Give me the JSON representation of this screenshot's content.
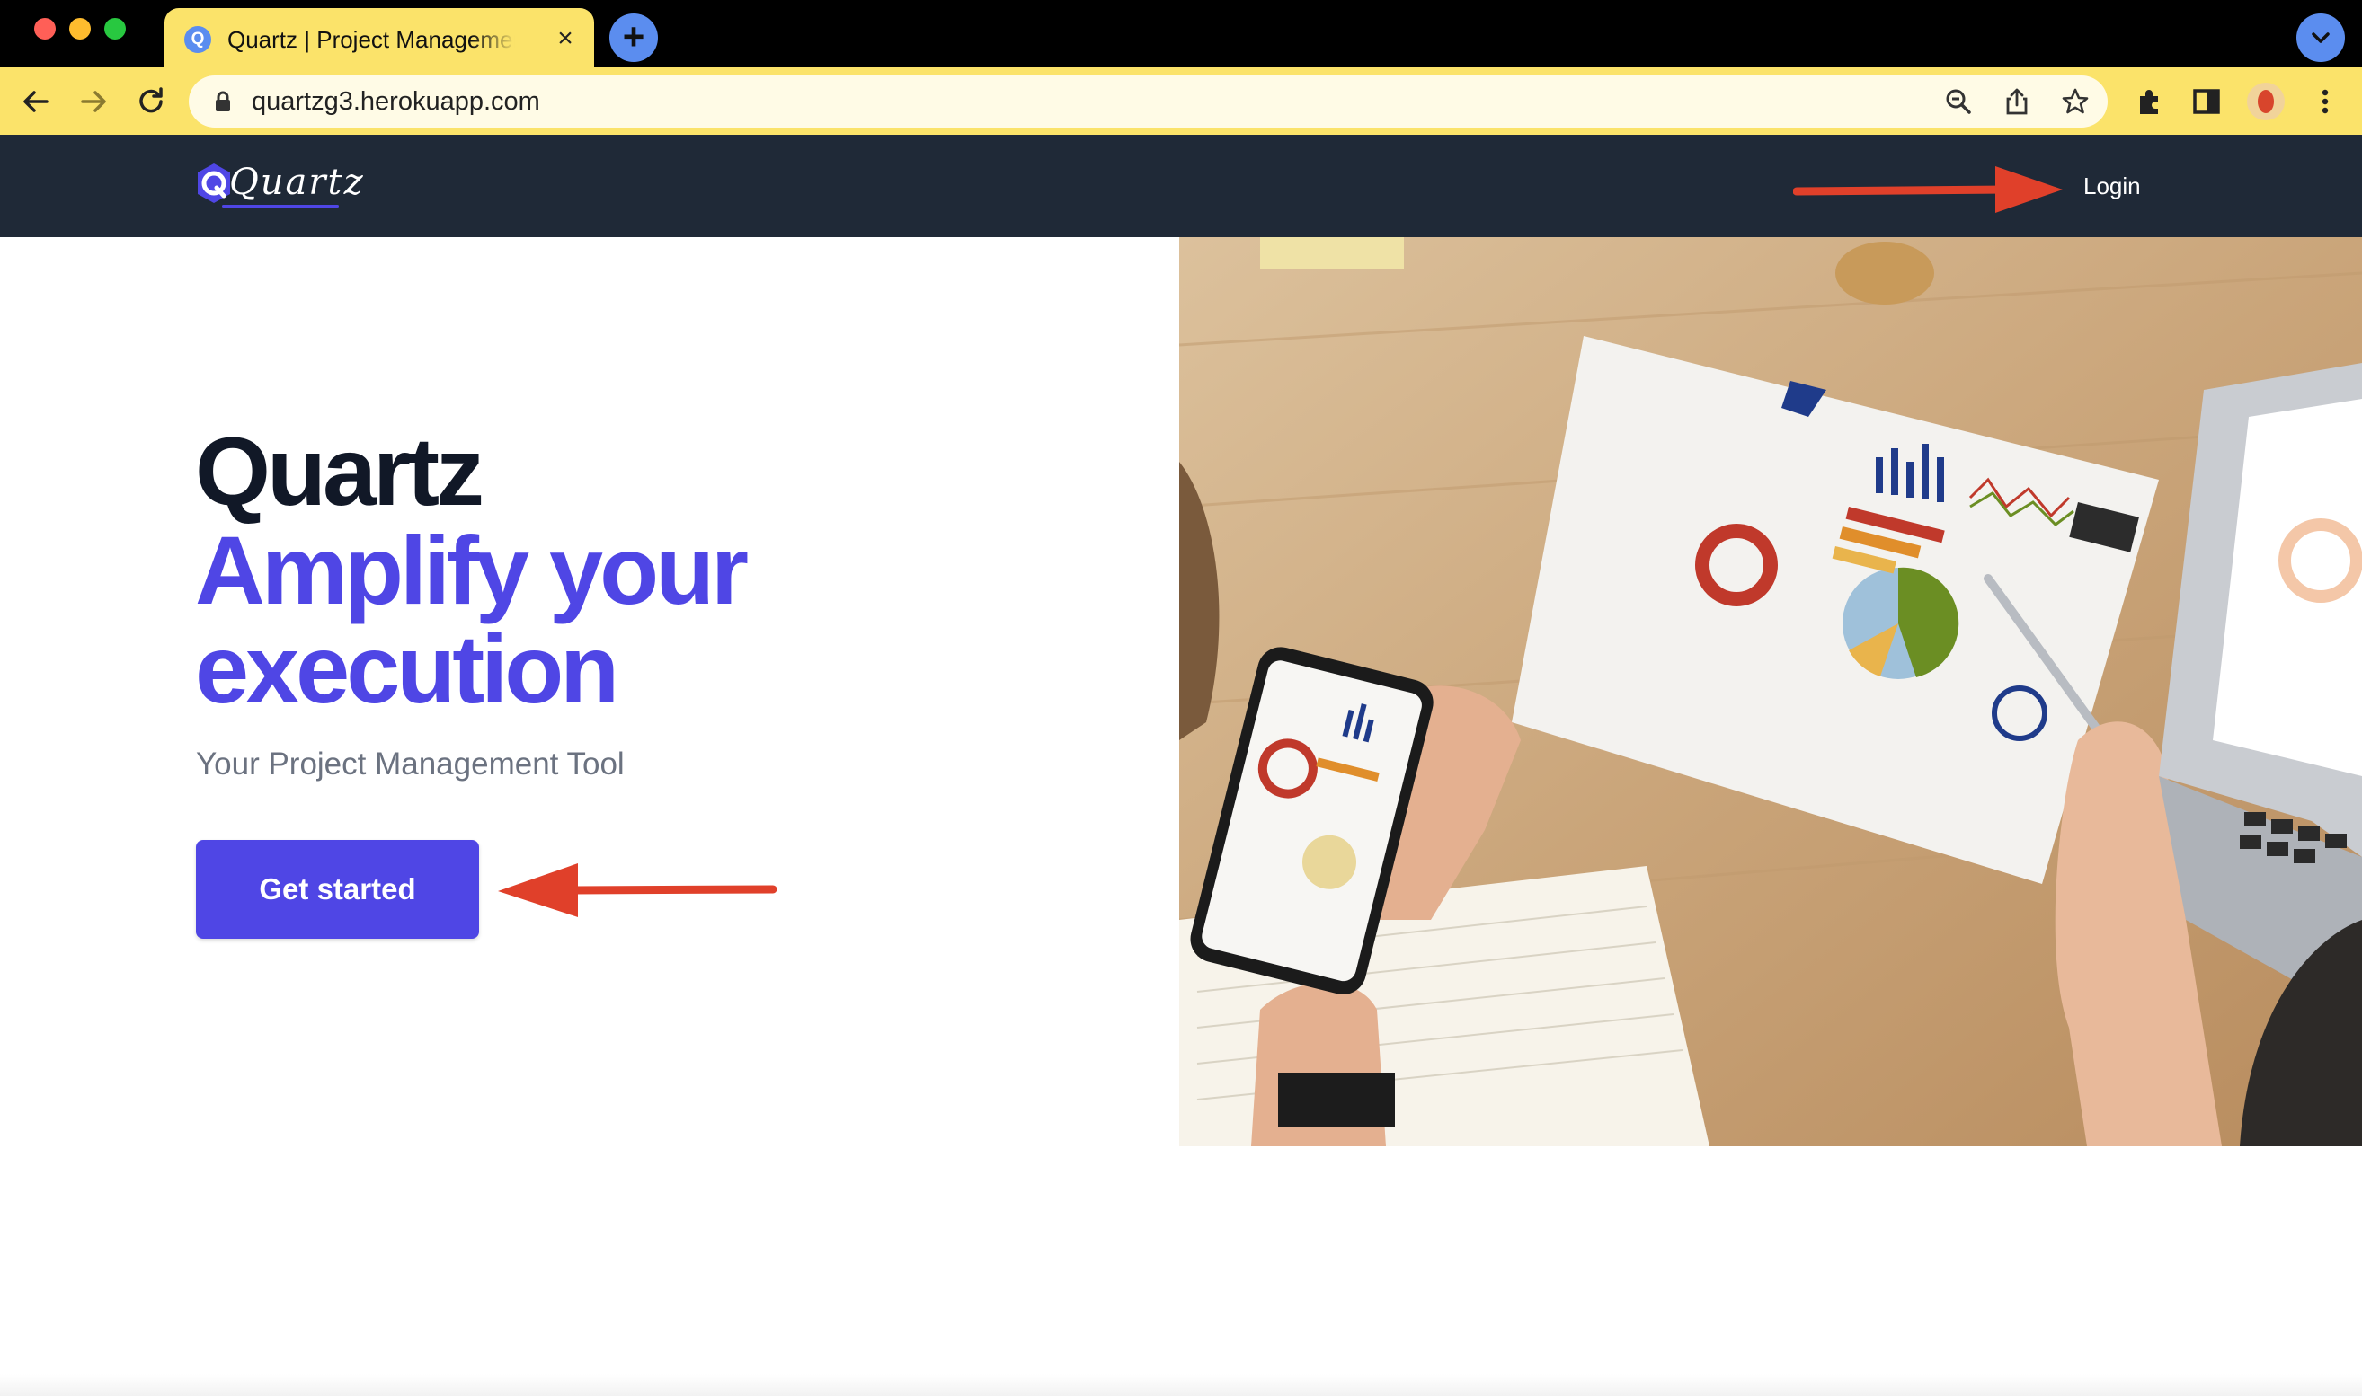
{
  "browser": {
    "tab_title": "Quartz | Project Management Tool",
    "tab_favicon_letter": "Q",
    "url": "quartzg3.herokuapp.com",
    "chrome_color": "#fbe36a"
  },
  "nav": {
    "logo_text": "Quartz",
    "login_label": "Login",
    "background": "#1f2937"
  },
  "hero": {
    "title_line1": "Quartz",
    "title_line2a": "Amplify your",
    "title_line2b": "execution",
    "subtitle": "Your Project Management Tool",
    "cta_label": "Get started",
    "accent": "#4f46e5"
  },
  "icons": [
    "back-icon",
    "forward-icon",
    "reload-icon",
    "lock-icon",
    "zoom-icon",
    "share-icon",
    "bookmark-star-icon",
    "extensions-icon",
    "side-panel-icon",
    "profile-avatar",
    "more-menu-icon",
    "tab-search-icon",
    "new-tab-icon",
    "tab-close-icon"
  ]
}
